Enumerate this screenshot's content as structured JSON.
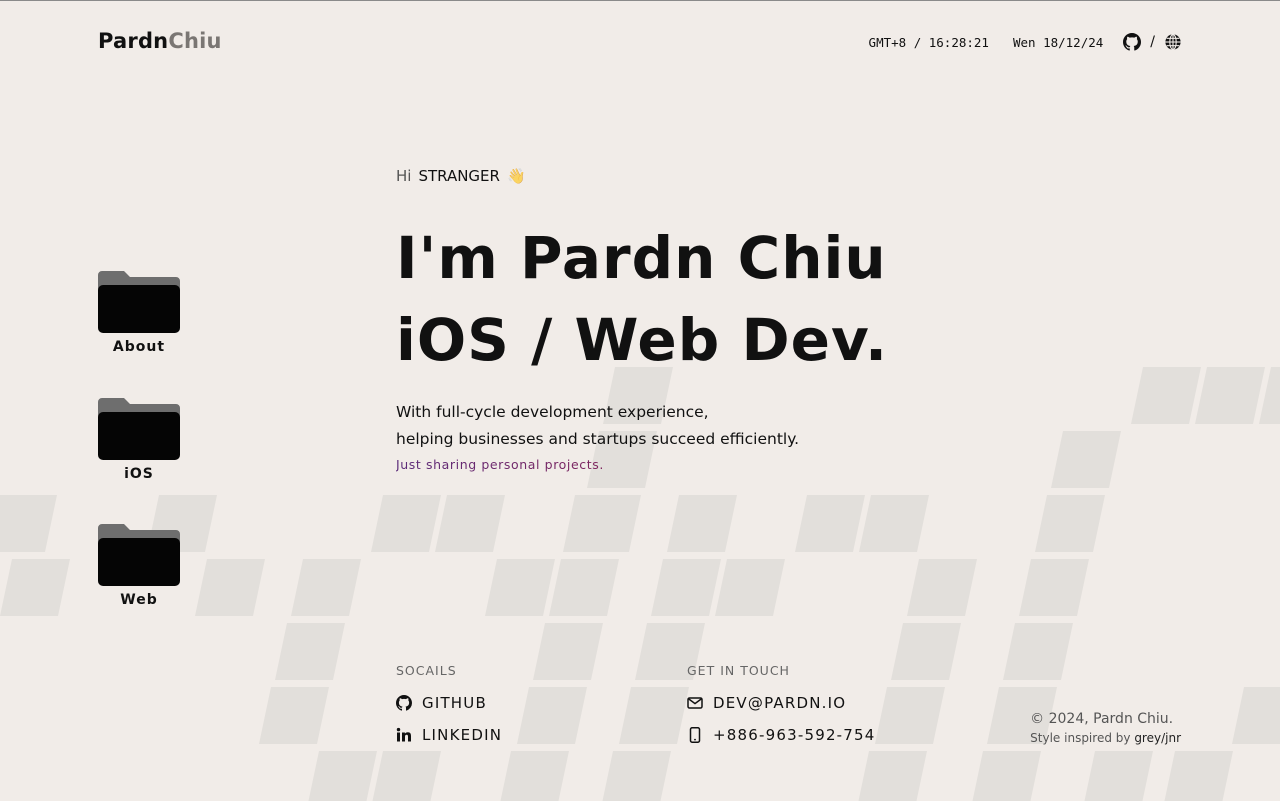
{
  "header": {
    "logo_primary": "Pardn",
    "logo_secondary": "Chiu",
    "clock": "GMT+8 / 16:28:21",
    "date": "Wen 18/12/24",
    "separator": "/",
    "icons": [
      "github-icon",
      "globe-icon"
    ]
  },
  "folders": [
    {
      "label": "About"
    },
    {
      "label": "iOS"
    },
    {
      "label": "Web"
    }
  ],
  "hero": {
    "greeting": "Hi",
    "visitor": "STRANGER",
    "wave": "👋",
    "title_line1": "I'm Pardn Chiu",
    "title_line2": "iOS / Web Dev.",
    "intro_line1": "With full-cycle development experience,",
    "intro_line2": "helping businesses and startups succeed efficiently.",
    "tagline": "Just sharing personal projects."
  },
  "socials": {
    "heading": "SOCAILS",
    "github": "GITHUB",
    "linkedin": "LINKEDIN"
  },
  "contact": {
    "heading": "GET IN TOUCH",
    "email": "DEV@PARDN.IO",
    "phone": "+886-963-592-754"
  },
  "footer": {
    "copyright": "© 2024, Pardn Chiu.",
    "credit_prefix": "Style inspired by",
    "credit_link": "grey/jnr"
  },
  "colors": {
    "background": "#f1ece8",
    "tile": "#e2dfdb",
    "folder": "#050505",
    "folder_tab": "#6e6e6e",
    "tagline_gradient": [
      "#5b2b7a",
      "#b01d38"
    ]
  }
}
